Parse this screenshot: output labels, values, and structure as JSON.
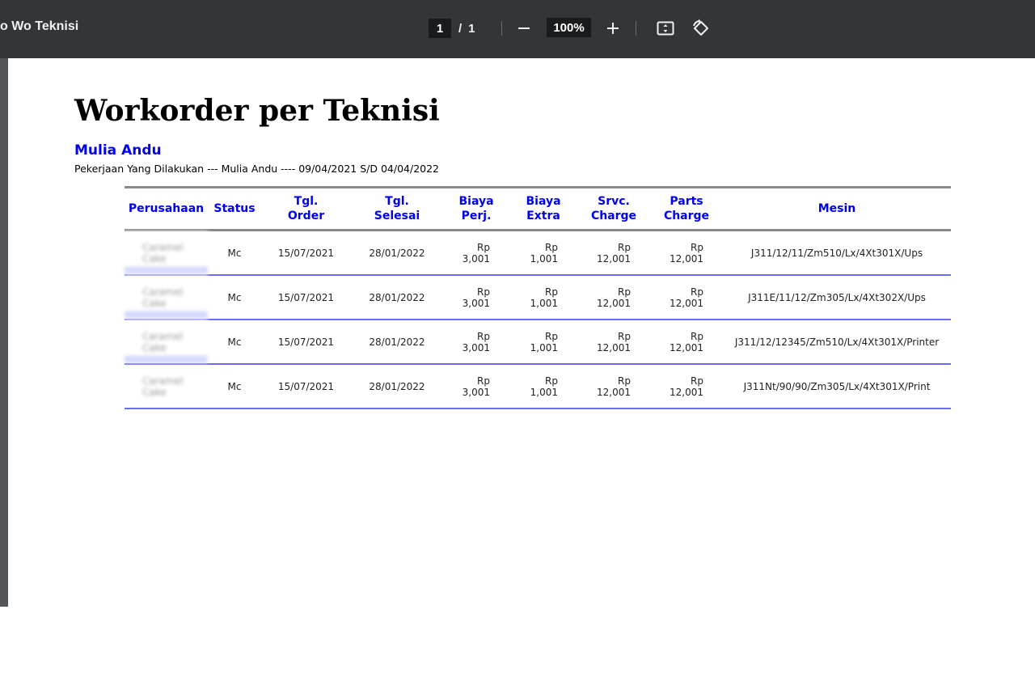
{
  "toolbar": {
    "title": "o Wo Teknisi",
    "page_current": "1",
    "page_separator": "/",
    "page_total": "1",
    "zoom": "100%"
  },
  "icons": [
    "minus-icon",
    "plus-icon",
    "fit-page-icon",
    "rotate-icon"
  ],
  "report": {
    "title": "Workorder per Teknisi",
    "technician": "Mulia Andu",
    "subtitle": "Pekerjaan Yang Dilakukan --- Mulia Andu ---- 09/04/2021 S/D 04/04/2022"
  },
  "table": {
    "headers": {
      "perusahaan": "Perusahaan",
      "status": "Status",
      "tgl_order": "Tgl. Order",
      "tgl_selesai": "Tgl. Selesai",
      "biaya_perj": "Biaya Perj.",
      "biaya_extra": "Biaya Extra",
      "srvc_charge": "Srvc. Charge",
      "parts_charge": "Parts Charge",
      "mesin": "Mesin"
    },
    "rows": [
      {
        "perusahaan": "Caramel Cake",
        "status": "Mc",
        "tgl_order": "15/07/2021",
        "tgl_selesai": "28/01/2022",
        "biaya_perj": "Rp 3,001",
        "biaya_extra": "Rp 1,001",
        "srvc_charge": "Rp 12,001",
        "parts_charge": "Rp 12,001",
        "mesin": "J311/12/11/Zm510/Lx/4Xt301X/Ups"
      },
      {
        "perusahaan": "Caramel Cake",
        "status": "Mc",
        "tgl_order": "15/07/2021",
        "tgl_selesai": "28/01/2022",
        "biaya_perj": "Rp 3,001",
        "biaya_extra": "Rp 1,001",
        "srvc_charge": "Rp 12,001",
        "parts_charge": "Rp 12,001",
        "mesin": "J311E/11/12/Zm305/Lx/4Xt302X/Ups"
      },
      {
        "perusahaan": "Caramel Cake",
        "status": "Mc",
        "tgl_order": "15/07/2021",
        "tgl_selesai": "28/01/2022",
        "biaya_perj": "Rp 3,001",
        "biaya_extra": "Rp 1,001",
        "srvc_charge": "Rp 12,001",
        "parts_charge": "Rp 12,001",
        "mesin": "J311/12/12345/Zm510/Lx/4Xt301X/Printer"
      },
      {
        "perusahaan": "Caramel Cake",
        "status": "Mc",
        "tgl_order": "15/07/2021",
        "tgl_selesai": "28/01/2022",
        "biaya_perj": "Rp 3,001",
        "biaya_extra": "Rp 1,001",
        "srvc_charge": "Rp 12,001",
        "parts_charge": "Rp 12,001",
        "mesin": "J311Nt/90/90/Zm305/Lx/4Xt301X/Print"
      }
    ]
  }
}
